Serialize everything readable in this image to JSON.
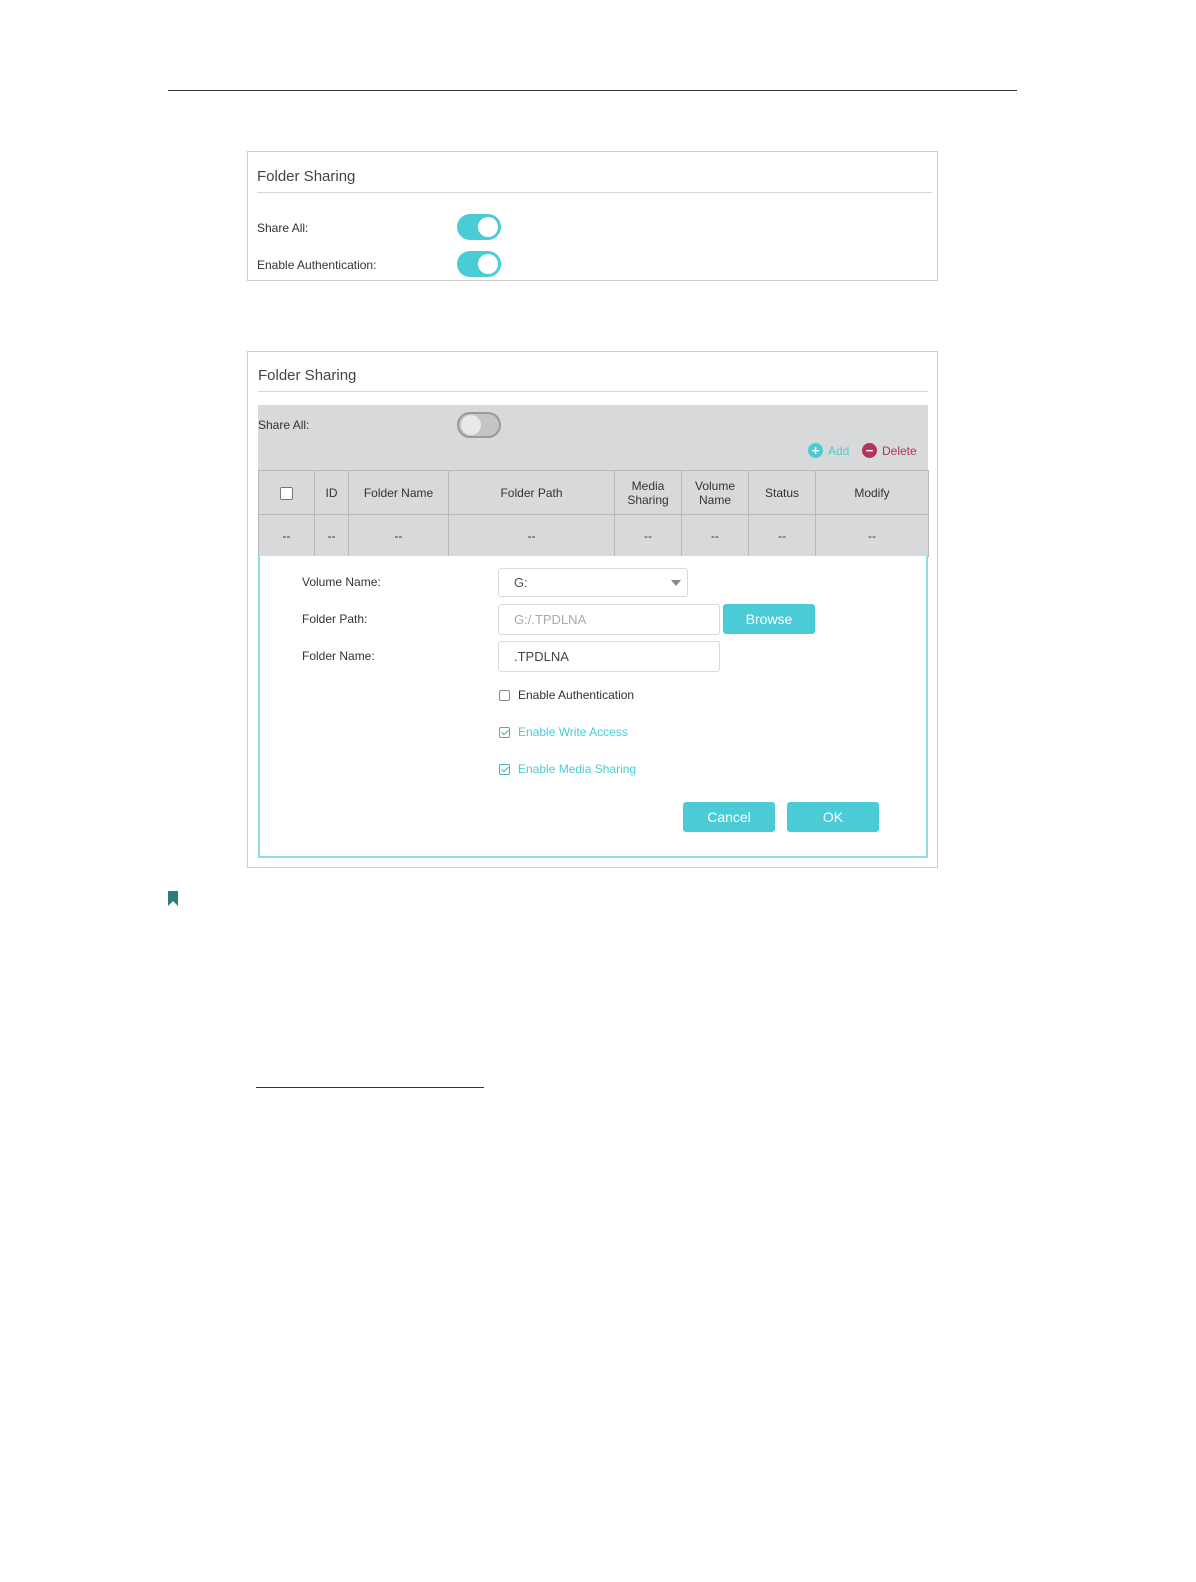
{
  "panel_top": {
    "title": "Folder Sharing",
    "share_all_label": "Share All:",
    "share_all_on": true,
    "auth_label": "Enable Authentication:",
    "auth_on": true
  },
  "panel_bottom": {
    "title": "Folder Sharing",
    "share_all_label": "Share All:",
    "share_all_on": false,
    "add_label": "Add",
    "delete_label": "Delete",
    "table": {
      "headers": [
        "",
        "ID",
        "Folder Name",
        "Folder Path",
        "Media\nSharing",
        "Volume\nName",
        "Status",
        "Modify"
      ],
      "rows": [
        [
          "--",
          "--",
          "--",
          "--",
          "--",
          "--",
          "--",
          "--"
        ]
      ]
    },
    "form": {
      "volume_label": "Volume Name:",
      "volume_value": "G:",
      "path_label": "Folder Path:",
      "path_value": "G:/.TPDLNA",
      "browse_label": "Browse",
      "name_label": "Folder Name:",
      "name_value": ".TPDLNA",
      "checkboxes": [
        {
          "label": "Enable Authentication",
          "checked": false
        },
        {
          "label": "Enable Write Access",
          "checked": true
        },
        {
          "label": "Enable Media Sharing",
          "checked": true
        }
      ],
      "cancel_label": "Cancel",
      "ok_label": "OK"
    }
  },
  "colors": {
    "accent": "#4acbd6",
    "delete": "#b5325c",
    "bookmark": "#2e7d7a"
  },
  "icons": [
    "bookmark-icon",
    "add-icon",
    "delete-icon",
    "chevron-down-icon"
  ]
}
